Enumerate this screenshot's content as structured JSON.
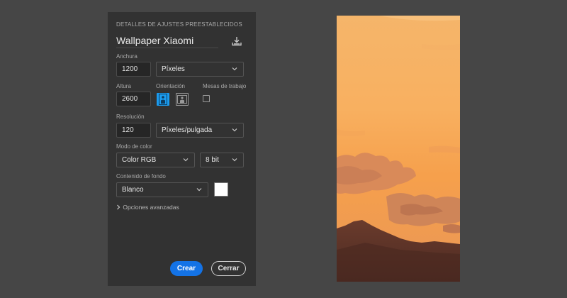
{
  "panel": {
    "section_title": "DETALLES DE AJUSTES PREESTABLECIDOS",
    "preset_name": "Wallpaper Xiaomi",
    "save_icon": "save-preset-icon",
    "width": {
      "label": "Anchura",
      "value": "1200",
      "unit": "Píxeles"
    },
    "height": {
      "label": "Altura",
      "value": "2600"
    },
    "orientation": {
      "label": "Orientación",
      "selected": "portrait",
      "options": [
        "portrait-icon",
        "landscape-icon"
      ]
    },
    "artboards": {
      "label": "Mesas de trabajo",
      "checked": false
    },
    "resolution": {
      "label": "Resolución",
      "value": "120",
      "unit": "Píxeles/pulgada"
    },
    "color_mode": {
      "label": "Modo de color",
      "mode": "Color RGB",
      "depth": "8 bit"
    },
    "background": {
      "label": "Contenido de fondo",
      "value": "Blanco",
      "swatch_color": "#ffffff"
    },
    "advanced_options": "Opciones avanzadas",
    "create_button": "Crear",
    "close_button": "Cerrar"
  },
  "colors": {
    "workspace": "#464646",
    "panel": "#323232",
    "accent": "#1473e6",
    "selected_orientation": "#1b9cf0"
  }
}
